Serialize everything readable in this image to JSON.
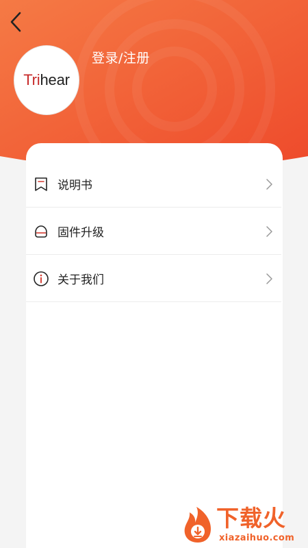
{
  "header": {
    "login_label": "登录/注册",
    "logo_prefix": "Tri",
    "logo_suffix": "hear",
    "gradient_start": "#f46f40",
    "gradient_end": "#ef4a2c"
  },
  "menu": {
    "items": [
      {
        "label": "说明书",
        "icon": "manual-icon"
      },
      {
        "label": "固件升级",
        "icon": "firmware-icon"
      },
      {
        "label": "关于我们",
        "icon": "info-icon"
      }
    ]
  },
  "watermark": {
    "title": "下载火",
    "subtitle": "xiazaihuo.com",
    "color": "#f0622a"
  }
}
